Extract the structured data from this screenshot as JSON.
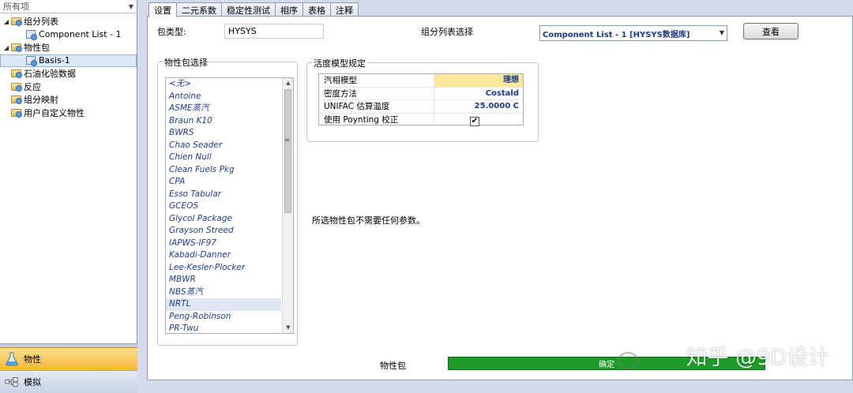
{
  "left_pane": {
    "header_label": "所有项",
    "tree": [
      {
        "label": "组分列表",
        "level": 0,
        "expanded": true
      },
      {
        "label": "Component List - 1",
        "level": 1
      },
      {
        "label": "物性包",
        "level": 0,
        "expanded": true
      },
      {
        "label": "Basis-1",
        "level": 1,
        "selected": true
      },
      {
        "label": "石油化验数据",
        "level": 0
      },
      {
        "label": "反应",
        "level": 0
      },
      {
        "label": "组分映射",
        "level": 0
      },
      {
        "label": "用户自定义物性",
        "level": 0
      }
    ],
    "nav_buttons": [
      {
        "label": "物性",
        "active": true,
        "icon": "flask-icon"
      },
      {
        "label": "模拟",
        "active": false,
        "icon": "flowsheet-icon"
      }
    ]
  },
  "tabs": [
    "设置",
    "二元系数",
    "稳定性测试",
    "相序",
    "表格",
    "注释"
  ],
  "settings": {
    "package_type_label": "包类型:",
    "package_type_value": "HYSYS",
    "component_list_label": "组分列表选择",
    "component_list_value": "Component List - 1 [HYSYS数据库]",
    "view_button": "查看",
    "property_package_group": "物性包选择",
    "property_packages": [
      "<无>",
      "Antoine",
      "ASME蒸汽",
      "Braun K10",
      "BWRS",
      "Chao Seader",
      "Chien Null",
      "Clean Fuels Pkg",
      "CPA",
      "Esso Tabular",
      "GCEOS",
      "Glycol Package",
      "Grayson Streed",
      "IAPWS-IF97",
      "Kabadi-Danner",
      "Lee-Kesler-Plocker",
      "MBWR",
      "NBS蒸汽",
      "NRTL",
      "Peng-Robinson",
      "PR-Twu"
    ],
    "selected_package": "NRTL",
    "activity_group": "活度模型规定",
    "activity_rows": [
      {
        "label": "汽相模型",
        "value": "理想"
      },
      {
        "label": "密度方法",
        "value": "Costald"
      },
      {
        "label": "UNIFAC 估算温度",
        "value": "25.0000 C"
      },
      {
        "label": "使用 Poynting 校正",
        "value": "✔"
      }
    ],
    "no_params_msg": "所选物性包不需要任何参数。"
  },
  "footer": {
    "label": "物性包",
    "status_text": "确定",
    "status_color": "#1e9b2a"
  },
  "watermark": "知乎 @9D设计"
}
